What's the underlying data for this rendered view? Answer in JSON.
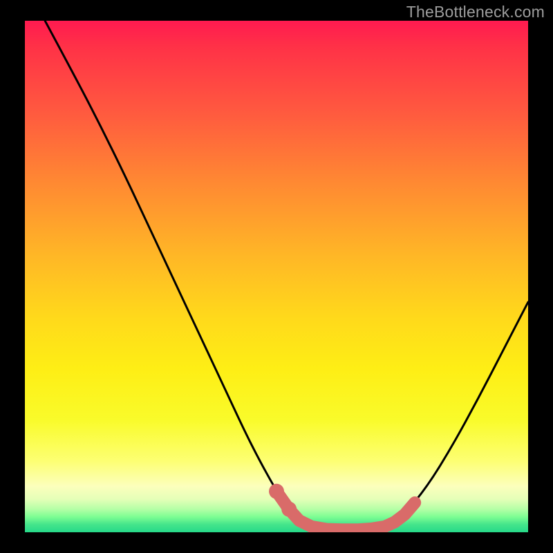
{
  "watermark": "TheBottleneck.com",
  "colors": {
    "page_bg": "#000000",
    "curve_stroke": "#000000",
    "marker_fill": "#d96b69",
    "marker_stroke": "#d96b69"
  },
  "chart_data": {
    "type": "line",
    "title": "",
    "xlabel": "",
    "ylabel": "",
    "xlim": [
      0,
      100
    ],
    "ylim": [
      0,
      100
    ],
    "grid": false,
    "series": [
      {
        "name": "bottleneck-curve",
        "x": [
          4,
          10,
          15,
          20,
          25,
          30,
          35,
          40,
          45,
          50,
          53,
          55,
          57,
          62,
          67,
          72,
          75,
          80,
          85,
          90,
          95,
          100
        ],
        "values": [
          100,
          89,
          79.5,
          69.5,
          59,
          48.5,
          38,
          27.5,
          17,
          8,
          3.5,
          2,
          1,
          0.5,
          0.5,
          1.2,
          3,
          9,
          17,
          26,
          35.5,
          45
        ]
      }
    ],
    "markers": [
      {
        "x": 50,
        "y": 8
      },
      {
        "x": 52.5,
        "y": 4.5
      },
      {
        "x": 54.5,
        "y": 2.3
      },
      {
        "x": 57,
        "y": 1.1
      },
      {
        "x": 60,
        "y": 0.6
      },
      {
        "x": 63,
        "y": 0.5
      },
      {
        "x": 66,
        "y": 0.5
      },
      {
        "x": 69,
        "y": 0.7
      },
      {
        "x": 71.5,
        "y": 1.1
      },
      {
        "x": 73.5,
        "y": 2.0
      },
      {
        "x": 75.5,
        "y": 3.5
      },
      {
        "x": 77.5,
        "y": 5.8
      }
    ],
    "annotations": []
  }
}
